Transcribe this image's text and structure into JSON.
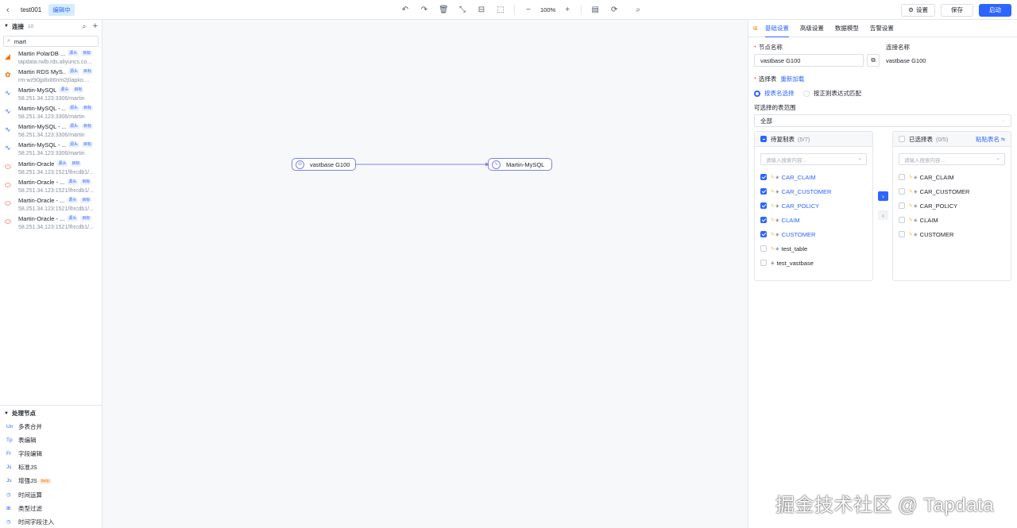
{
  "header": {
    "back_icon": "chevron-left-icon",
    "task_name": "test001",
    "status_badge": "编辑中",
    "zoom": "100%",
    "settings_label": "设置",
    "save_label": "保存",
    "start_label": "启动"
  },
  "sidebar": {
    "connections_title": "连接",
    "connections_count": "10",
    "search_value": "mart",
    "connections": [
      {
        "name": "Martin PolarDB ...",
        "address": "tapdata.rwlb.rds.aliyuncs.co...",
        "tags": [
          "源头",
          "目标"
        ],
        "icon": "polardb-icon",
        "icon_color": "#ff6a00",
        "glyph": "◢"
      },
      {
        "name": "Martin RDS MyS...",
        "address": "rm-wz90jp8x86nm2j0apko....",
        "tags": [
          "源头",
          "目标"
        ],
        "icon": "rds-mysql-icon",
        "icon_color": "#ff6a00",
        "glyph": "✿"
      },
      {
        "name": "Martin-MySQL",
        "address": "58.251.34.123:3306/martin",
        "tags": [
          "源头",
          "目标"
        ],
        "icon": "mysql-icon",
        "icon_color": "#2c65ff",
        "glyph": "∿"
      },
      {
        "name": "Martin-MySQL - ...",
        "address": "58.251.34.123:3306/martin",
        "tags": [
          "源头",
          "目标"
        ],
        "icon": "mysql-icon",
        "icon_color": "#2c65ff",
        "glyph": "∿"
      },
      {
        "name": "Martin-MySQL - ...",
        "address": "58.251.34.123:3306/martin",
        "tags": [
          "源头",
          "目标"
        ],
        "icon": "mysql-icon",
        "icon_color": "#2c65ff",
        "glyph": "∿"
      },
      {
        "name": "Martin-MySQL - ...",
        "address": "58.251.34.123:3306/martin",
        "tags": [
          "源头",
          "目标"
        ],
        "icon": "mysql-icon",
        "icon_color": "#2c65ff",
        "glyph": "∿"
      },
      {
        "name": "Martin-Oracle",
        "address": "58.251.34.123:1521/lhrcdb1/...",
        "tags": [
          "源头",
          "目标"
        ],
        "icon": "oracle-icon",
        "icon_color": "#f53f3f",
        "glyph": "⬭"
      },
      {
        "name": "Martin-Oracle - ...",
        "address": "58.251.34.123:1521/lhrcdb1/...",
        "tags": [
          "源头",
          "目标"
        ],
        "icon": "oracle-icon",
        "icon_color": "#f53f3f",
        "glyph": "⬭"
      },
      {
        "name": "Martin-Oracle - ...",
        "address": "58.251.34.123:1521/lhrcdb1/...",
        "tags": [
          "源头",
          "目标"
        ],
        "icon": "oracle-icon",
        "icon_color": "#f53f3f",
        "glyph": "⬭"
      },
      {
        "name": "Martin-Oracle - ...",
        "address": "58.251.34.123:1521/lhrcdb1/...",
        "tags": [
          "源头",
          "目标"
        ],
        "icon": "oracle-icon",
        "icon_color": "#f53f3f",
        "glyph": "⬭"
      }
    ],
    "processing_title": "处理节点",
    "processing": [
      {
        "label": "多表合并",
        "icon": "Un"
      },
      {
        "label": "表编辑",
        "icon": "Tp"
      },
      {
        "label": "字段编辑",
        "icon": "Fr"
      },
      {
        "label": "标准JS",
        "icon": "Js"
      },
      {
        "label": "增强JS",
        "icon": "Js",
        "beta": "beta"
      },
      {
        "label": "时间运算",
        "icon": "◷"
      },
      {
        "label": "类型过滤",
        "icon": "⊞"
      },
      {
        "label": "时间字段注入",
        "icon": "◷"
      }
    ]
  },
  "canvas": {
    "source_node": "vastbase G100",
    "target_node": "Martin-MySQL"
  },
  "panel": {
    "tabs": [
      "基础设置",
      "高级设置",
      "数据模型",
      "告警设置"
    ],
    "node_name_label": "节点名称",
    "node_name_value": "vastbase G100",
    "conn_name_label": "连接名称",
    "conn_name_value": "vastbase G100",
    "select_table_label": "选择表",
    "reload_label": "重新加载",
    "radio_by_name": "按表名选择",
    "radio_by_regex": "按正则表达式匹配",
    "range_label": "可选择的表范围",
    "range_value": "全部",
    "left_pane": {
      "title": "待复制表",
      "count": "(5/7)",
      "search_placeholder": "请输入搜索内容...",
      "items": [
        {
          "name": "CAR_CLAIM",
          "checked": true,
          "key": true
        },
        {
          "name": "CAR_CUSTOMER",
          "checked": true,
          "key": true
        },
        {
          "name": "CAR_POLICY",
          "checked": true,
          "key": true
        },
        {
          "name": "CLAIM",
          "checked": true,
          "key": true
        },
        {
          "name": "CUSTOMER",
          "checked": true,
          "key": true
        },
        {
          "name": "test_table",
          "checked": false,
          "key": true
        },
        {
          "name": "test_vastbase",
          "checked": false,
          "key": false
        }
      ]
    },
    "right_pane": {
      "title": "已选择表",
      "count": "(0/5)",
      "paste_label": "粘贴表名",
      "search_placeholder": "请输入搜索内容...",
      "items": [
        {
          "name": "CAR_CLAIM"
        },
        {
          "name": "CAR_CUSTOMER"
        },
        {
          "name": "CAR_POLICY"
        },
        {
          "name": "CLAIM"
        },
        {
          "name": "CUSTOMER"
        }
      ]
    }
  },
  "watermark": "掘金技术社区 @ Tapdata"
}
